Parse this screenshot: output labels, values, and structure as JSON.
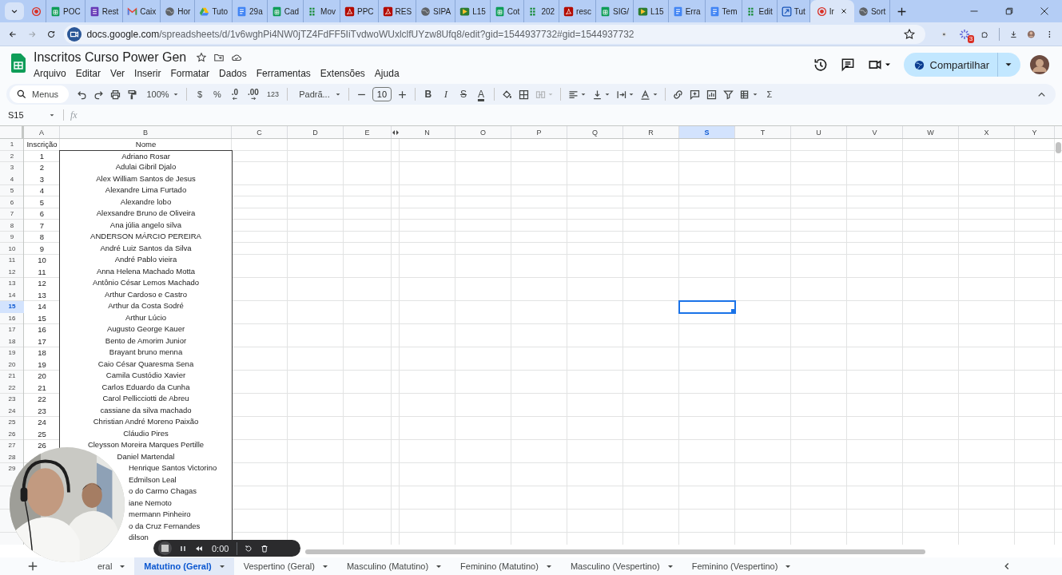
{
  "browser": {
    "tabs": [
      {
        "kind": "record",
        "selected": false
      },
      {
        "kind": "sheets",
        "title": "POC",
        "selected": false
      },
      {
        "kind": "forms",
        "title": "Rest",
        "selected": false
      },
      {
        "kind": "mail",
        "title": "Caix",
        "selected": false
      },
      {
        "kind": "globe",
        "title": "Hor",
        "selected": false
      },
      {
        "kind": "drive",
        "title": "Tuto",
        "selected": false
      },
      {
        "kind": "docs",
        "title": "29a",
        "selected": false
      },
      {
        "kind": "sheets",
        "title": "Cad",
        "selected": false
      },
      {
        "kind": "dots",
        "title": "Mov",
        "selected": false
      },
      {
        "kind": "pdf",
        "title": "PPC",
        "selected": false
      },
      {
        "kind": "pdf",
        "title": "RES",
        "selected": false
      },
      {
        "kind": "globe",
        "title": "SIPA",
        "selected": false
      },
      {
        "kind": "media",
        "title": "L15",
        "selected": false
      },
      {
        "kind": "sheets",
        "title": "Cot",
        "selected": false
      },
      {
        "kind": "dots",
        "title": "202",
        "selected": false
      },
      {
        "kind": "pdf",
        "title": "resc",
        "selected": false
      },
      {
        "kind": "sheets",
        "title": "SIG/",
        "selected": false
      },
      {
        "kind": "media",
        "title": "L15",
        "selected": false
      },
      {
        "kind": "docs",
        "title": "Erra",
        "selected": false
      },
      {
        "kind": "docs",
        "title": "Tem",
        "selected": false
      },
      {
        "kind": "dots",
        "title": "Edit",
        "selected": false
      },
      {
        "kind": "box",
        "title": "Tut",
        "selected": false
      },
      {
        "kind": "record",
        "title": "Ir",
        "selected": true
      },
      {
        "kind": "globe",
        "title": "Sort",
        "selected": false
      }
    ],
    "url": {
      "domain": "docs.google.com",
      "path": "/spreadsheets/d/1v6wghPi4NW0jTZ4FdFF5IiTvdwoWUxlclfUYzw8Ufq8/edit?gid=1544937732#gid=1544937732"
    },
    "extension_badge": "3"
  },
  "document": {
    "title": "Inscritos Curso Power Gen",
    "menus": [
      "Arquivo",
      "Editar",
      "Ver",
      "Inserir",
      "Formatar",
      "Dados",
      "Ferramentas",
      "Extensões",
      "Ajuda"
    ],
    "share_button": "Compartilhar"
  },
  "toolbar": {
    "search_placeholder": "Menus",
    "zoom": "100%",
    "currency": "$",
    "percent": "%",
    "decrease_decimals": ".0",
    "increase_decimals": ".00",
    "more_formats": "123",
    "font": "Padrã...",
    "font_size": "10",
    "bold": "B",
    "italic": "I",
    "strikethrough": "S",
    "text_color": "A",
    "sum": "Σ"
  },
  "formula_bar": {
    "cell_ref": "S15",
    "fx": "fx"
  },
  "grid": {
    "columns": [
      {
        "label": "A",
        "selected": false
      },
      {
        "label": "B",
        "selected": false
      },
      {
        "label": "C",
        "selected": false
      },
      {
        "label": "D",
        "selected": false
      },
      {
        "label": "E",
        "selected": false
      },
      {
        "label": "N",
        "selected": false
      },
      {
        "label": "O",
        "selected": false
      },
      {
        "label": "P",
        "selected": false
      },
      {
        "label": "Q",
        "selected": false
      },
      {
        "label": "R",
        "selected": false
      },
      {
        "label": "S",
        "selected": true
      },
      {
        "label": "T",
        "selected": false
      },
      {
        "label": "U",
        "selected": false
      },
      {
        "label": "V",
        "selected": false
      },
      {
        "label": "W",
        "selected": false
      },
      {
        "label": "X",
        "selected": false
      },
      {
        "label": "Y",
        "selected": false
      }
    ],
    "rows": [
      {
        "number": "1",
        "selected": false,
        "a": "Inscrição",
        "b": "Nome"
      },
      {
        "number": "2",
        "selected": false,
        "a": "1",
        "b": "Adriano Rosar"
      },
      {
        "number": "3",
        "selected": false,
        "a": "2",
        "b": "Adulai Gibril Djalo"
      },
      {
        "number": "4",
        "selected": false,
        "a": "3",
        "b": "Alex William Santos de Jesus"
      },
      {
        "number": "5",
        "selected": false,
        "a": "4",
        "b": "Alexandre Lima Furtado"
      },
      {
        "number": "6",
        "selected": false,
        "a": "5",
        "b": "Alexandre lobo"
      },
      {
        "number": "7",
        "selected": false,
        "a": "6",
        "b": "Alexsandre Bruno de Oliveira"
      },
      {
        "number": "8",
        "selected": false,
        "a": "7",
        "b": "Ana júlia angelo silva"
      },
      {
        "number": "9",
        "selected": false,
        "a": "8",
        "b": "ANDERSON MÁRCIO PEREIRA"
      },
      {
        "number": "10",
        "selected": false,
        "a": "9",
        "b": "André Luiz Santos da Silva"
      },
      {
        "number": "11",
        "selected": false,
        "a": "10",
        "b": "André Pablo vieira"
      },
      {
        "number": "12",
        "selected": false,
        "a": "11",
        "b": "Anna Helena Machado Motta"
      },
      {
        "number": "13",
        "selected": false,
        "a": "12",
        "b": "Antônio César Lemos Machado"
      },
      {
        "number": "14",
        "selected": false,
        "a": "13",
        "b": "Arthur Cardoso e Castro"
      },
      {
        "number": "15",
        "selected": true,
        "a": "14",
        "b": "Arthur da Costa Sodré"
      },
      {
        "number": "16",
        "selected": false,
        "a": "15",
        "b": "Arthur Lúcio"
      },
      {
        "number": "17",
        "selected": false,
        "a": "16",
        "b": "Augusto George Kauer"
      },
      {
        "number": "18",
        "selected": false,
        "a": "17",
        "b": "Bento de Amorim Junior"
      },
      {
        "number": "19",
        "selected": false,
        "a": "18",
        "b": "Brayant bruno menna"
      },
      {
        "number": "20",
        "selected": false,
        "a": "19",
        "b": "Caio César Quaresma Sena"
      },
      {
        "number": "21",
        "selected": false,
        "a": "20",
        "b": "Camila Custódio Xavier"
      },
      {
        "number": "22",
        "selected": false,
        "a": "21",
        "b": "Carlos Eduardo da Cunha"
      },
      {
        "number": "23",
        "selected": false,
        "a": "22",
        "b": "Carol Pellicciotti de Abreu"
      },
      {
        "number": "24",
        "selected": false,
        "a": "23",
        "b": "cassiane da silva machado"
      },
      {
        "number": "25",
        "selected": false,
        "a": "24",
        "b": "Christian André Moreno Paixão"
      },
      {
        "number": "26",
        "selected": false,
        "a": "25",
        "b": "Cláudio Pires"
      },
      {
        "number": "27",
        "selected": false,
        "a": "26",
        "b": "Cleysson Moreira Marques Pertille"
      },
      {
        "number": "28",
        "selected": false,
        "b": "Daniel Martendal"
      },
      {
        "number": "29",
        "selected": false,
        "b": "Henrique Santos Victorino",
        "cut": true
      },
      {
        "selected": false,
        "b": "Edmilson Leal",
        "cut": true
      },
      {
        "selected": false,
        "b": "o do Carmo Chagas",
        "cut": true
      },
      {
        "selected": false,
        "b": "iane Nemoto",
        "cut": true
      },
      {
        "selected": false,
        "b": "mermann Pinheiro",
        "cut": true
      },
      {
        "selected": false,
        "b": "o da Cruz Fernandes",
        "cut": true
      },
      {
        "selected": false,
        "b": "dilson",
        "cut": true
      }
    ]
  },
  "recorder": {
    "time": "0:00"
  },
  "sheet_tabs": [
    {
      "label": "eral",
      "selected": false
    },
    {
      "label": "Matutino (Geral)",
      "selected": true
    },
    {
      "label": "Vespertino (Geral)",
      "selected": false
    },
    {
      "label": "Masculino (Matutino)",
      "selected": false
    },
    {
      "label": "Feminino (Matutino)",
      "selected": false
    },
    {
      "label": "Masculino (Vespertino)",
      "selected": false
    },
    {
      "label": "Feminino (Vespertino)",
      "selected": false
    }
  ]
}
